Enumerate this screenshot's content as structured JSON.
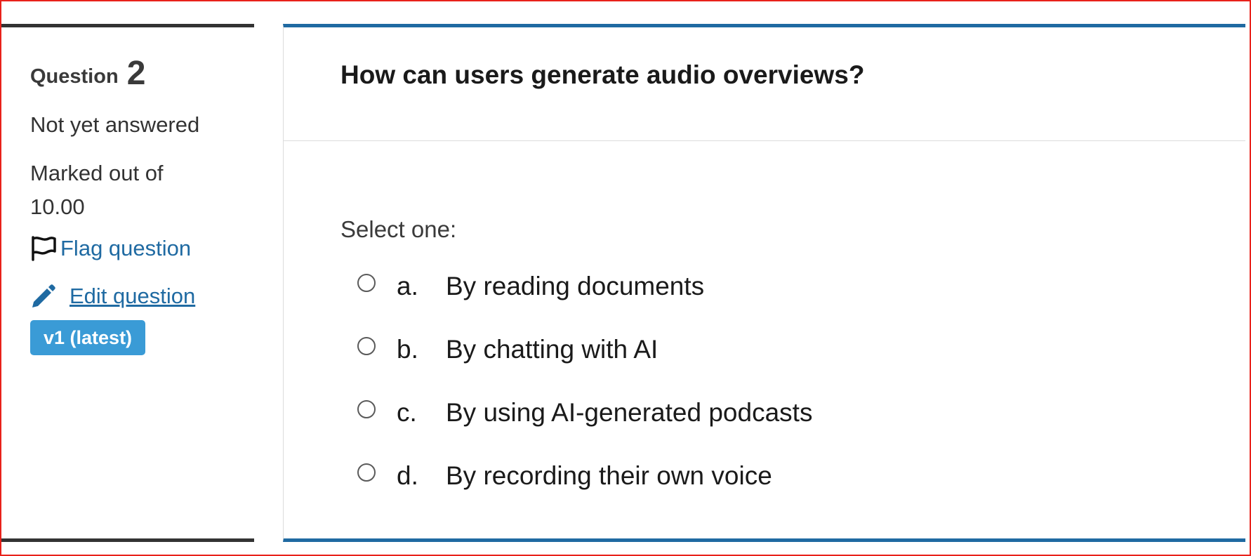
{
  "info": {
    "question_label": "Question",
    "question_number": "2",
    "state": "Not yet answered",
    "grade_line1": "Marked out of",
    "grade_line2": "10.00",
    "flag_label": "Flag question",
    "edit_label": "Edit question",
    "version_badge": "v1 (latest)",
    "icons": {
      "flag": "flag-outline-icon",
      "edit": "pencil-icon"
    }
  },
  "question": {
    "text": "How can users generate audio overviews?",
    "prompt": "Select one:",
    "answers": [
      {
        "letter": "a.",
        "text": "By reading documents"
      },
      {
        "letter": "b.",
        "text": "By chatting with AI"
      },
      {
        "letter": "c.",
        "text": "By using AI-generated podcasts"
      },
      {
        "letter": "d.",
        "text": "By recording their own voice"
      }
    ]
  },
  "colors": {
    "accent": "#1f6aa2",
    "badge": "#3a9bd6",
    "dark_rule": "#333333",
    "frame": "#e8221b"
  }
}
